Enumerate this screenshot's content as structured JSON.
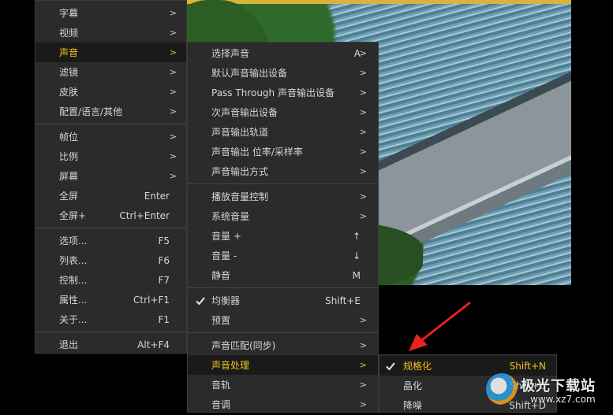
{
  "menu_main": {
    "items": [
      {
        "label": "字幕",
        "shortcut": "",
        "submenu": true
      },
      {
        "label": "视频",
        "shortcut": "",
        "submenu": true
      },
      {
        "label": "声音",
        "shortcut": "",
        "submenu": true,
        "active": true
      },
      {
        "label": "滤镜",
        "shortcut": "",
        "submenu": true
      },
      {
        "label": "皮肤",
        "shortcut": "",
        "submenu": true
      },
      {
        "label": "配置/语言/其他",
        "shortcut": "",
        "submenu": true
      },
      {
        "label": "帧位",
        "shortcut": "",
        "submenu": true
      },
      {
        "label": "比例",
        "shortcut": "",
        "submenu": true
      },
      {
        "label": "屏幕",
        "shortcut": "",
        "submenu": true
      },
      {
        "label": "全屏",
        "shortcut": "Enter",
        "submenu": false
      },
      {
        "label": "全屏+",
        "shortcut": "Ctrl+Enter",
        "submenu": false
      },
      {
        "label": "选项...",
        "shortcut": "F5",
        "submenu": false
      },
      {
        "label": "列表...",
        "shortcut": "F6",
        "submenu": false
      },
      {
        "label": "控制...",
        "shortcut": "F7",
        "submenu": false
      },
      {
        "label": "属性...",
        "shortcut": "Ctrl+F1",
        "submenu": false
      },
      {
        "label": "关于...",
        "shortcut": "F1",
        "submenu": false
      },
      {
        "label": "退出",
        "shortcut": "Alt+F4",
        "submenu": false
      }
    ]
  },
  "menu_sound": {
    "items": [
      {
        "label": "选择声音",
        "shortcut": "A",
        "submenu": true
      },
      {
        "label": "默认声音输出设备",
        "shortcut": "",
        "submenu": true
      },
      {
        "label": "Pass Through 声音输出设备",
        "shortcut": "",
        "submenu": true
      },
      {
        "label": "次声音输出设备",
        "shortcut": "",
        "submenu": true
      },
      {
        "label": "声音输出轨道",
        "shortcut": "",
        "submenu": true
      },
      {
        "label": "声音输出 位率/采样率",
        "shortcut": "",
        "submenu": true
      },
      {
        "label": "声音输出方式",
        "shortcut": "",
        "submenu": true
      },
      {
        "label": "播放音量控制",
        "shortcut": "",
        "submenu": true
      },
      {
        "label": "系统音量",
        "shortcut": "",
        "submenu": true
      },
      {
        "label": "音量 +",
        "shortcut": "↑",
        "submenu": false
      },
      {
        "label": "音量 -",
        "shortcut": "↓",
        "submenu": false
      },
      {
        "label": "静音",
        "shortcut": "M",
        "submenu": false
      },
      {
        "label": "均衡器",
        "shortcut": "Shift+E",
        "submenu": false,
        "checked": true
      },
      {
        "label": "预置",
        "shortcut": "",
        "submenu": true
      },
      {
        "label": "声音匹配(同步)",
        "shortcut": "",
        "submenu": true
      },
      {
        "label": "声音处理",
        "shortcut": "",
        "submenu": true,
        "active": true
      },
      {
        "label": "音轨",
        "shortcut": "",
        "submenu": true
      },
      {
        "label": "音调",
        "shortcut": "",
        "submenu": true
      }
    ]
  },
  "menu_processing": {
    "items": [
      {
        "label": "规格化",
        "shortcut": "Shift+N",
        "checked": true,
        "active": true
      },
      {
        "label": "晶化",
        "shortcut": "Shift+C"
      },
      {
        "label": "降噪",
        "shortcut": "Shift+D"
      }
    ]
  },
  "submenu_arrow": ">",
  "watermark": {
    "text": "极光下载站",
    "url": "www.xz7.com"
  },
  "colors": {
    "menu_bg": "#2b2b2b",
    "active_bg": "#1a1a1a",
    "active_text": "#f0c419",
    "annotation_arrow": "#e8231e"
  }
}
